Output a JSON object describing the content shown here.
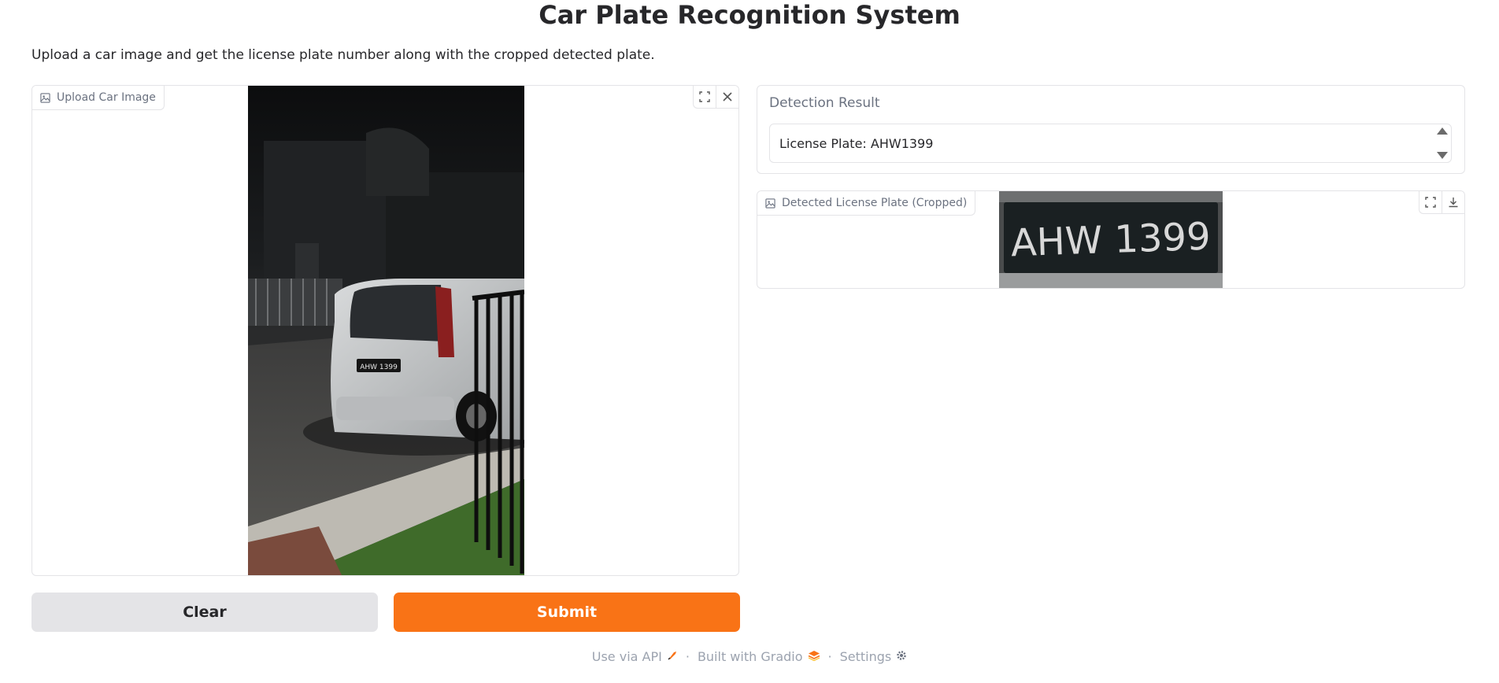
{
  "header": {
    "title": "Car Plate Recognition System",
    "description": "Upload a car image and get the license plate number along with the cropped detected plate."
  },
  "upload": {
    "label": "Upload Car Image",
    "icons": [
      "image-icon",
      "fullscreen-icon",
      "close-icon"
    ]
  },
  "buttons": {
    "clear_label": "Clear",
    "submit_label": "Submit"
  },
  "result": {
    "label": "Detection Result",
    "value": "License Plate: AHW1399"
  },
  "plate": {
    "label": "Detected License Plate (Cropped)",
    "plate_text": "AHW 1399",
    "icons": [
      "image-icon",
      "fullscreen-icon",
      "download-icon"
    ]
  },
  "car_image": {
    "plate_text": "AHW 1399"
  },
  "footer": {
    "api_label": "Use via API",
    "gradio_label": "Built with Gradio",
    "settings_label": "Settings",
    "separator": "·"
  },
  "colors": {
    "accent": "#f97316",
    "secondary_button": "#e4e4e7",
    "border": "#e4e4e7",
    "label_text": "#6b7280"
  }
}
